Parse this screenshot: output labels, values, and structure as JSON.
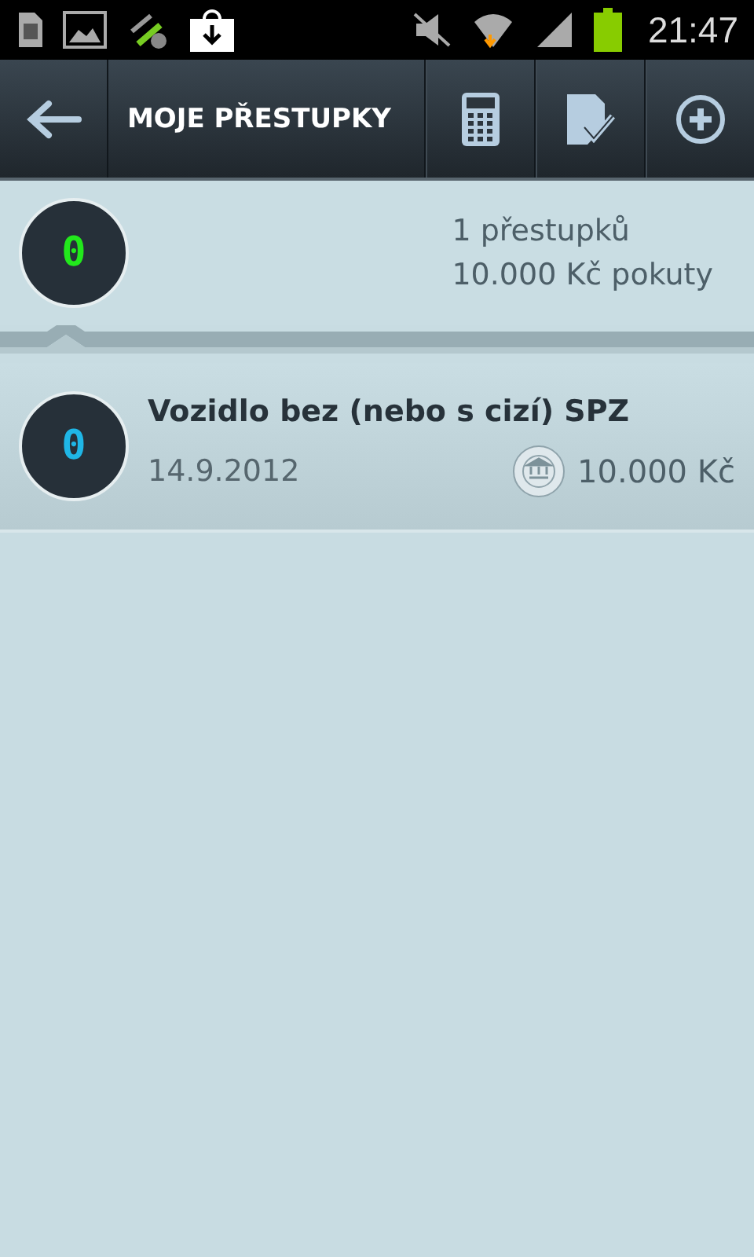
{
  "status_bar": {
    "time": "21:47"
  },
  "toolbar": {
    "title": "MOJE PŘESTUPKY"
  },
  "summary": {
    "badge": "0",
    "color": "#22e81c",
    "count": "1 přestupků",
    "total": "10.000 Kč pokuty"
  },
  "offenses": [
    {
      "badge": "0",
      "color": "#1fb6e6",
      "title": "Vozidlo bez (nebo s cizí) SPZ",
      "date": "14.9.2012",
      "amount": "10.000 Kč"
    }
  ]
}
